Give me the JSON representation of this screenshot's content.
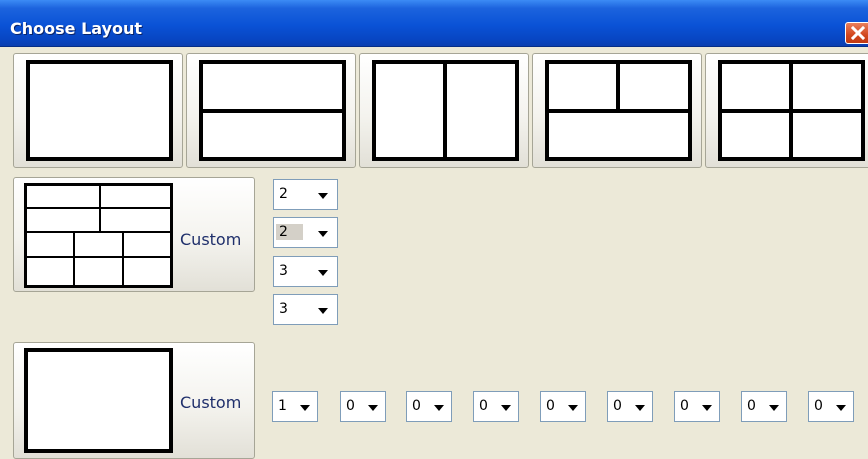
{
  "window": {
    "title": "Choose Layout"
  },
  "presets": [
    {
      "name": "single"
    },
    {
      "name": "two-rows"
    },
    {
      "name": "two-columns"
    },
    {
      "name": "two-top-one-bottom"
    },
    {
      "name": "grid-2x2"
    }
  ],
  "custom1": {
    "label": "Custom",
    "selectors": [
      "2",
      "2",
      "3",
      "3"
    ]
  },
  "custom2": {
    "label": "Custom",
    "selectors": [
      "1",
      "0",
      "0",
      "0",
      "0",
      "0",
      "0",
      "0",
      "0"
    ]
  }
}
